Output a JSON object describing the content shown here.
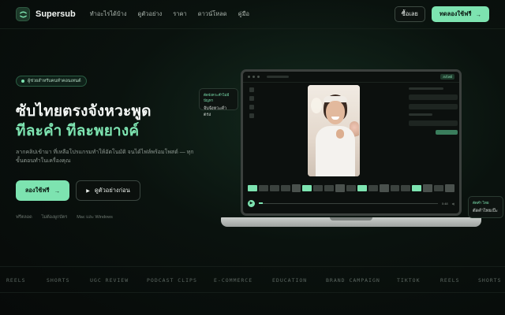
{
  "colors": {
    "accent": "#7de3b0",
    "background": "#070a09",
    "panel": "#0c100e"
  },
  "nav": {
    "brand": "Supersub",
    "links": [
      "ทำอะไรได้บ้าง",
      "ดูตัวอย่าง",
      "ราคา",
      "ดาวน์โหลด",
      "คู่มือ"
    ],
    "login_label": "ซื้อเลย",
    "try_label": "ทดลองใช้ฟรี"
  },
  "hero": {
    "badge": "ผู้ช่วยสำหรับคนทำคอนเทนต์",
    "title_line1": "ซับไทยตรงจังหวะพูด",
    "title_line2": "ทีละคำ ทีละพยางค์",
    "subtitle": "ลากคลิปเข้ามา ที่เหลือโปรแกรมทำให้อัตโนมัติ จนได้ไฟล์พร้อมโพสต์ — ทุกขั้นตอนทำในเครื่องคุณ",
    "primary_cta": "ลองใช้ฟรี",
    "secondary_cta": "ดูตัวอย่างก่อน",
    "notes": [
      "ฟรีตลอด",
      "ไม่ต้องผูกบัตร",
      "Mac และ Windows"
    ]
  },
  "app": {
    "chip": "ส่งไฟล์",
    "time": "0:48",
    "progress_fraction": 0.02
  },
  "float_left": {
    "line1": "ตัดจังหวะคำไม่มีปัญหา",
    "line2": "จับจังหวะคำตรง"
  },
  "float_right": {
    "line1": "ตัดคำ ไทย",
    "line2": "ตัดคำไทยเป๊ะ"
  },
  "ticker": [
    "REELS",
    "SHORTS",
    "UGC REVIEW",
    "PODCAST CLIPS",
    "E-COMMERCE",
    "EDUCATION",
    "BRAND CAMPAIGN",
    "TIKTOK",
    "REELS",
    "SHORTS"
  ]
}
